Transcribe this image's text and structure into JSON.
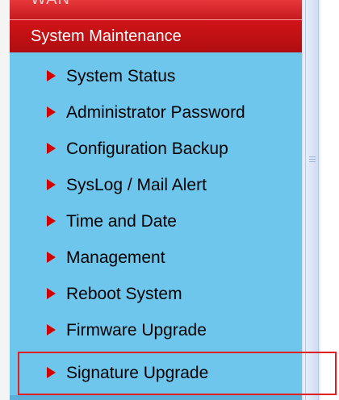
{
  "header": {
    "ghost_label": "WAN",
    "section_title": "System Maintenance"
  },
  "menu": {
    "items": [
      {
        "label": "System Status"
      },
      {
        "label": "Administrator Password"
      },
      {
        "label": "Configuration Backup"
      },
      {
        "label": "SysLog / Mail Alert"
      },
      {
        "label": "Time and Date"
      },
      {
        "label": "Management"
      },
      {
        "label": "Reboot System"
      },
      {
        "label": "Firmware Upgrade"
      },
      {
        "label": "Signature Upgrade",
        "highlighted": true
      }
    ]
  },
  "colors": {
    "menu_background": "#6fc6ec",
    "header_red": "#c41a1e",
    "arrow_red": "#d40000",
    "highlight_border": "#e02020"
  },
  "icons": {
    "item_bullet": "triangle-right-icon",
    "scroll_grip": "grip-icon"
  }
}
